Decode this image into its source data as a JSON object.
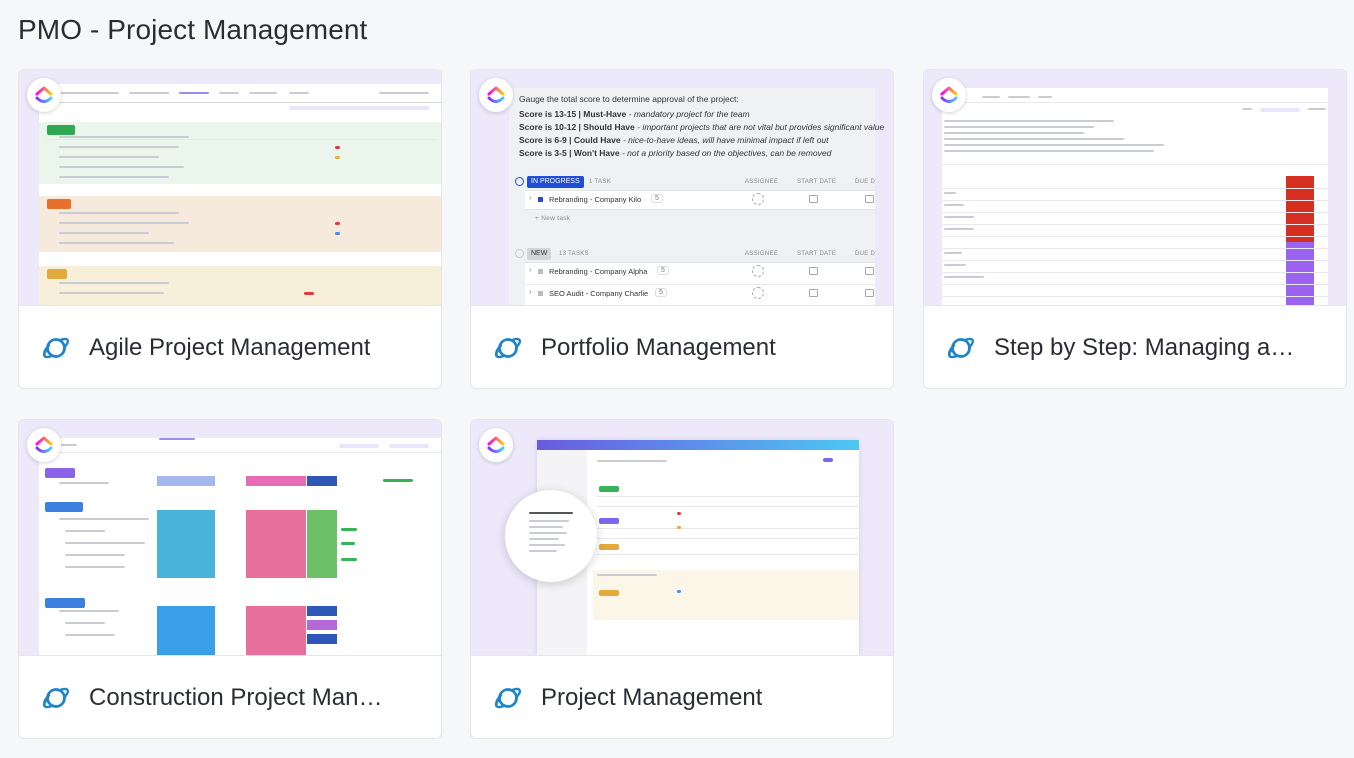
{
  "section": {
    "title": "PMO - Project Management"
  },
  "cards": [
    {
      "title": "Agile Project Management",
      "icon": "planet-icon"
    },
    {
      "title": "Portfolio Management",
      "icon": "planet-icon"
    },
    {
      "title": "Step by Step: Managing a…",
      "icon": "planet-icon"
    },
    {
      "title": "Construction Project Man…",
      "icon": "planet-icon"
    },
    {
      "title": "Project Management",
      "icon": "planet-icon"
    }
  ],
  "portfolio_preview": {
    "intro": "Gauge the total score to determine approval of the project:",
    "scores": [
      {
        "label": "Score is 13-15 | Must-Have",
        "desc": " - mandatory project for the team"
      },
      {
        "label": "Score is 10-12 | Should Have",
        "desc": " - important projects that are not vital but provides significant value"
      },
      {
        "label": "Score is 6-9 | Could Have",
        "desc": " - nice-to-have ideas, will have minimal impact if left out"
      },
      {
        "label": "Score is 3-5 | Won't Have",
        "desc": " - not a priority based on the objectives, can be removed"
      }
    ],
    "group1": {
      "status": "IN PROGRESS",
      "count": "1 TASK",
      "col_assignee": "ASSIGNEE",
      "col_start": "START DATE",
      "col_due": "DUE D"
    },
    "group1_task": {
      "name": "Rebranding - Company Kilo",
      "subtasks": "5"
    },
    "new_task": "+ New task",
    "group2": {
      "status": "NEW",
      "count": "13 TASKS",
      "col_assignee": "ASSIGNEE",
      "col_start": "START DATE",
      "col_due": "DUE D"
    },
    "group2_tasks": [
      {
        "name": "Rebranding - Company Alpha",
        "subtasks": "5"
      },
      {
        "name": "SEO Audit - Company Charlie",
        "subtasks": "5"
      }
    ]
  },
  "colors": {
    "brand_purple": "#7b68ee",
    "in_progress": "#1f4fd6",
    "new_status": "#d3d5da",
    "thumb_bg": "#ede9fb",
    "planet_blue": "#1e86c8"
  }
}
